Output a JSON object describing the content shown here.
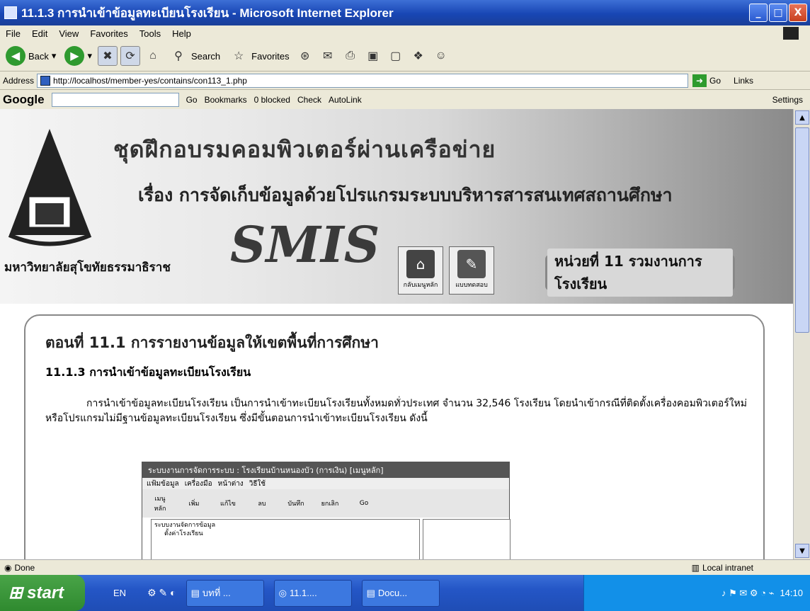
{
  "window": {
    "title": "11.1.3 การนำเข้าข้อมูลทะเบียนโรงเรียน - Microsoft Internet Explorer",
    "minimize": "_",
    "maximize": "□",
    "close": "X"
  },
  "menu": [
    "File",
    "Edit",
    "View",
    "Favorites",
    "Tools",
    "Help"
  ],
  "toolbar": {
    "back": "Back",
    "search": "Search",
    "favorites": "Favorites"
  },
  "address": {
    "label": "Address",
    "url": "http://localhost/member-yes/contains/con113_1.php",
    "go": "Go",
    "links": "Links"
  },
  "googlebar": {
    "logo": "Google",
    "go": "Go",
    "bookmarks": "Bookmarks",
    "blocked": "0 blocked",
    "check": "Check",
    "autolink": "AutoLink",
    "settings": "Settings"
  },
  "banner": {
    "title": "ชุดฝึกอบรมคอมพิวเตอร์ผ่านเครือข่าย",
    "subtitle": "เรื่อง การจัดเก็บข้อมูลด้วยโปรแกรมระบบบริหารสารสนเทศสถานศึกษา",
    "smis": "SMIS",
    "university": "มหาวิทยาลัยสุโขทัยธรรมาธิราช",
    "home_btn": "กลับเมนูหลัก",
    "eval_btn": "แบบทดสอบ",
    "unit": "หน่วยที่ 11 รวมงานการโรงเรียน"
  },
  "content": {
    "section_title": "ตอนที่ 11.1 การรายงานข้อมูลให้เขตพื้นที่การศึกษา",
    "sub_title": "11.1.3 การนำเข้าข้อมูลทะเบียนโรงเรียน",
    "paragraph": "การนำเข้าข้อมูลทะเบียนโรงเรียน เป็นการนำเข้าทะเบียนโรงเรียนทั้งหมดทั่วประเทศ จำนวน 32,546 โรงเรียน โดยนำเข้ากรณีที่ติดตั้งเครื่องคอมพิวเตอร์ใหม่ หรือโปรแกรมไม่มีฐานข้อมูลทะเบียนโรงเรียน ซึ่งมีขั้นตอนการนำเข้าทะเบียนโรงเรียน ดังนี้"
  },
  "embedded": {
    "title": "ระบบงานการจัดการระบบ : โรงเรียนบ้านหนองบัว (การเงิน) [เมนูหลัก]",
    "menu": [
      "แฟ้มข้อมูล",
      "เครื่องมือ",
      "หน้าต่าง",
      "วิธีใช้"
    ],
    "tools": [
      "เมนูหลัก",
      "เพิ่ม",
      "แก้ไข",
      "ลบ",
      "บันทึก",
      "ยกเลิก",
      "Go"
    ],
    "tree": [
      "ระบบงานจัดการข้อมูล",
      "ตั้งค่าโรงเรียน"
    ]
  },
  "status": {
    "done": "Done",
    "zone": "Local intranet"
  },
  "taskbar": {
    "start": "start",
    "lang": "EN",
    "tasks": [
      "บทที่ ...",
      "11.1....",
      "Docu..."
    ],
    "time": "14:10"
  }
}
